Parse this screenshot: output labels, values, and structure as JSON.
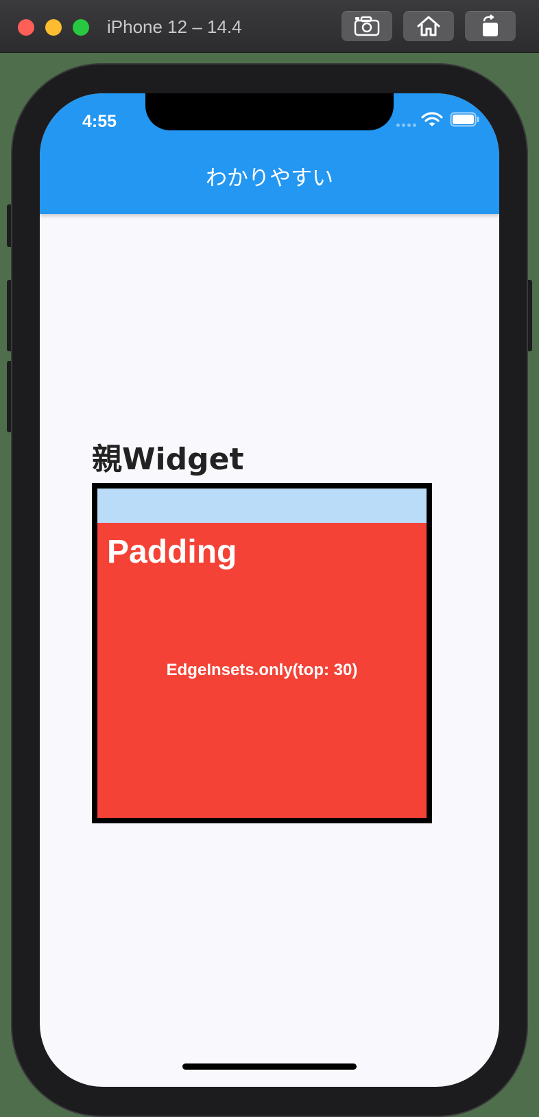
{
  "simulator": {
    "title": "iPhone 12 – 14.4",
    "buttons": [
      {
        "name": "screenshot",
        "icon": "camera-icon"
      },
      {
        "name": "home",
        "icon": "home-icon"
      },
      {
        "name": "rotate",
        "icon": "rotate-icon"
      }
    ]
  },
  "status_bar": {
    "time": "4:55",
    "icons": [
      "wifi-icon",
      "battery-icon"
    ]
  },
  "app_bar": {
    "title": "わかりやすい",
    "color": "#2397f1"
  },
  "content": {
    "parent_label": "親Widget",
    "padding_title": "Padding",
    "insets_text": "EdgeInsets.only(top: 30)",
    "colors": {
      "parent_background": "#bbdcf8",
      "child_background": "#f44236",
      "border": "#000000"
    }
  }
}
